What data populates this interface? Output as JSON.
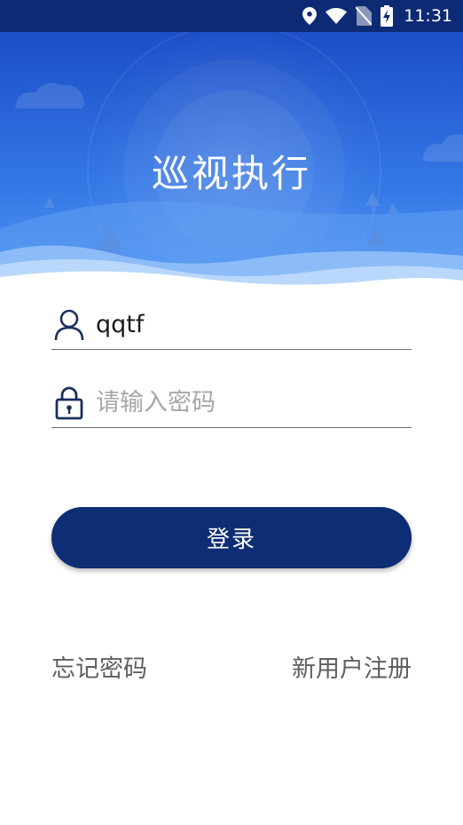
{
  "status_bar": {
    "time": "11:31",
    "icons": [
      "location-icon",
      "wifi-icon",
      "no-sim-icon",
      "battery-charging-icon"
    ]
  },
  "header": {
    "title": "巡视执行",
    "colors": {
      "top": "#1c4ec7",
      "bottom": "#4a8ff2",
      "wave_light": "#a9cdfa",
      "wave_mid": "#6aa9f6"
    }
  },
  "form": {
    "username": {
      "value": "qqtf",
      "icon": "user-icon"
    },
    "password": {
      "placeholder": "请输入密码",
      "icon": "lock-icon"
    }
  },
  "login_button": {
    "label": "登录",
    "color": "#0d2d74"
  },
  "links": {
    "forgot_password": "忘记密码",
    "register": "新用户注册"
  }
}
